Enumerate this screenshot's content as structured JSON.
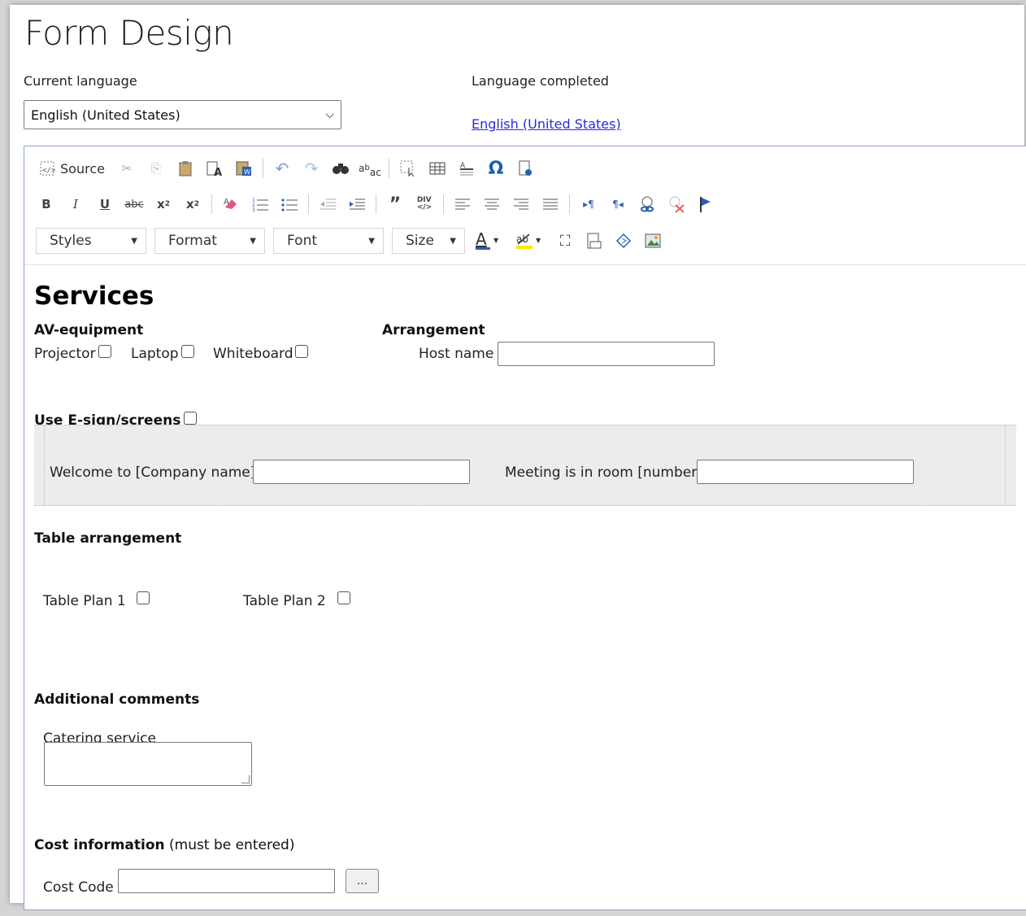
{
  "page": {
    "title": "Form Design",
    "current_language_label": "Current language",
    "current_language_value": "English (United States)",
    "language_completed_label": "Language completed",
    "language_completed_link": "English (United States)"
  },
  "toolbar": {
    "source_label": "Source",
    "styles_label": "Styles",
    "format_label": "Format",
    "font_label": "Font",
    "size_label": "Size"
  },
  "content": {
    "heading": "Services",
    "av_equipment": "AV-equipment",
    "projector": "Projector",
    "laptop": "Laptop",
    "whiteboard": "Whiteboard",
    "arrangement": "Arrangement",
    "host_name": "Host name",
    "use_esign": "Use E-sign/screens",
    "welcome_label": "Welcome to [Company name]",
    "meeting_label": "Meeting is in room [number]",
    "table_arrangement": "Table arrangement",
    "table_plan_1": "Table Plan 1",
    "table_plan_2": "Table Plan 2",
    "additional_comments": "Additional comments",
    "catering_service": "Catering service",
    "cost_information": "Cost information",
    "cost_information_note": "(must be entered)",
    "cost_code": "Cost Code",
    "browse_button": "..."
  },
  "colors": {
    "link": "#2a2ad8",
    "editor_border": "#8aa4c8",
    "band_background": "#ececec"
  },
  "icons": [
    "source-icon",
    "cut-icon",
    "copy-icon",
    "paste-icon",
    "paste-text-icon",
    "paste-word-icon",
    "undo-icon",
    "redo-icon",
    "find-icon",
    "replace-icon",
    "select-all-icon",
    "table-icon",
    "horizontal-line-icon",
    "special-char-icon",
    "page-break-icon",
    "bold-icon",
    "italic-icon",
    "underline-icon",
    "strike-icon",
    "subscript-icon",
    "superscript-icon",
    "remove-format-icon",
    "numbered-list-icon",
    "bulleted-list-icon",
    "outdent-icon",
    "indent-icon",
    "blockquote-icon",
    "div-icon",
    "align-left-icon",
    "align-center-icon",
    "align-right-icon",
    "justify-icon",
    "ltr-icon",
    "rtl-icon",
    "link-icon",
    "unlink-icon",
    "anchor-icon",
    "text-color-icon",
    "bg-color-icon",
    "maximize-icon",
    "show-blocks-icon",
    "flash-icon",
    "image-icon"
  ]
}
